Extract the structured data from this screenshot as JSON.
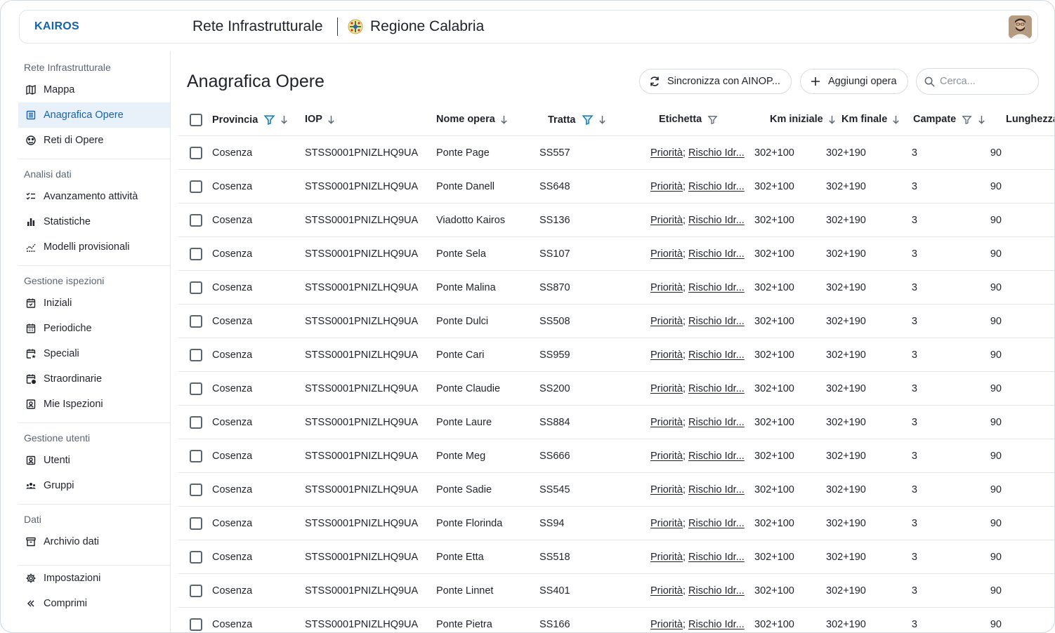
{
  "header": {
    "logo": "KAIROS",
    "app_title": "Rete Infrastrutturale",
    "region": "Regione Calabria"
  },
  "sidebar": {
    "sections": [
      {
        "title": "Rete Infrastrutturale",
        "items": [
          {
            "label": "Mappa",
            "icon": "map-icon"
          },
          {
            "label": "Anagrafica Opere",
            "icon": "table-icon",
            "active": true
          },
          {
            "label": "Reti di Opere",
            "icon": "network-icon"
          }
        ]
      },
      {
        "title": "Analisi dati",
        "items": [
          {
            "label": "Avanzamento attività",
            "icon": "checklist-icon"
          },
          {
            "label": "Statistiche",
            "icon": "bar-chart-icon"
          },
          {
            "label": "Modelli provisionali",
            "icon": "trend-icon"
          }
        ]
      },
      {
        "title": "Gestione ispezioni",
        "items": [
          {
            "label": "Iniziali",
            "icon": "calendar-icon"
          },
          {
            "label": "Periodiche",
            "icon": "calendar-grid-icon"
          },
          {
            "label": "Speciali",
            "icon": "calendar-star-icon"
          },
          {
            "label": "Straordinarie",
            "icon": "calendar-alert-icon"
          },
          {
            "label": "Mie Ispezioni",
            "icon": "user-badge-icon"
          }
        ]
      },
      {
        "title": "Gestione utenti",
        "items": [
          {
            "label": "Utenti",
            "icon": "user-icon"
          },
          {
            "label": "Gruppi",
            "icon": "group-icon"
          }
        ]
      },
      {
        "title": "Dati",
        "items": [
          {
            "label": "Archivio dati",
            "icon": "archive-icon"
          }
        ]
      }
    ],
    "footer": [
      {
        "label": "Impostazioni",
        "icon": "gear-icon"
      },
      {
        "label": "Comprimi",
        "icon": "double-chevron-left-icon"
      }
    ]
  },
  "main": {
    "title": "Anagrafica Opere",
    "sync_button": "Sincronizza con AINOP...",
    "add_button": "Aggiungi opera",
    "search_placeholder": "Cerca..."
  },
  "table": {
    "columns": [
      "Provincia",
      "IOP",
      "Nome opera",
      "Tratta",
      "Etichetta",
      "Km iniziale",
      "Km finale",
      "Campate",
      "Lunghezza"
    ],
    "rows": [
      {
        "provincia": "Cosenza",
        "iop": "STSS0001PNIZLHQ9UA",
        "nome": "Ponte Page",
        "tratta": "SS557",
        "tag1": "Priorità",
        "tag2": "Rischio Idr...",
        "km_iniziale": "302+100",
        "km_finale": "302+190",
        "campate": "3",
        "lunghezza": "90"
      },
      {
        "provincia": "Cosenza",
        "iop": "STSS0001PNIZLHQ9UA",
        "nome": "Ponte Danell",
        "tratta": "SS648",
        "tag1": "Priorità",
        "tag2": "Rischio Idr...",
        "km_iniziale": "302+100",
        "km_finale": "302+190",
        "campate": "3",
        "lunghezza": "90"
      },
      {
        "provincia": "Cosenza",
        "iop": "STSS0001PNIZLHQ9UA",
        "nome": "Viadotto Kairos",
        "tratta": "SS136",
        "tag1": "Priorità",
        "tag2": "Rischio Idr...",
        "km_iniziale": "302+100",
        "km_finale": "302+190",
        "campate": "3",
        "lunghezza": "90"
      },
      {
        "provincia": "Cosenza",
        "iop": "STSS0001PNIZLHQ9UA",
        "nome": "Ponte Sela",
        "tratta": "SS107",
        "tag1": "Priorità",
        "tag2": "Rischio Idr...",
        "km_iniziale": "302+100",
        "km_finale": "302+190",
        "campate": "3",
        "lunghezza": "90"
      },
      {
        "provincia": "Cosenza",
        "iop": "STSS0001PNIZLHQ9UA",
        "nome": "Ponte Malina",
        "tratta": "SS870",
        "tag1": "Priorità",
        "tag2": "Rischio Idr...",
        "km_iniziale": "302+100",
        "km_finale": "302+190",
        "campate": "3",
        "lunghezza": "90"
      },
      {
        "provincia": "Cosenza",
        "iop": "STSS0001PNIZLHQ9UA",
        "nome": "Ponte Dulci",
        "tratta": "SS508",
        "tag1": "Priorità",
        "tag2": "Rischio Idr...",
        "km_iniziale": "302+100",
        "km_finale": "302+190",
        "campate": "3",
        "lunghezza": "90"
      },
      {
        "provincia": "Cosenza",
        "iop": "STSS0001PNIZLHQ9UA",
        "nome": "Ponte Cari",
        "tratta": "SS959",
        "tag1": "Priorità",
        "tag2": "Rischio Idr...",
        "km_iniziale": "302+100",
        "km_finale": "302+190",
        "campate": "3",
        "lunghezza": "90"
      },
      {
        "provincia": "Cosenza",
        "iop": "STSS0001PNIZLHQ9UA",
        "nome": "Ponte Claudie",
        "tratta": "SS200",
        "tag1": "Priorità",
        "tag2": "Rischio Idr...",
        "km_iniziale": "302+100",
        "km_finale": "302+190",
        "campate": "3",
        "lunghezza": "90"
      },
      {
        "provincia": "Cosenza",
        "iop": "STSS0001PNIZLHQ9UA",
        "nome": "Ponte Laure",
        "tratta": "SS884",
        "tag1": "Priorità",
        "tag2": "Rischio Idr...",
        "km_iniziale": "302+100",
        "km_finale": "302+190",
        "campate": "3",
        "lunghezza": "90"
      },
      {
        "provincia": "Cosenza",
        "iop": "STSS0001PNIZLHQ9UA",
        "nome": "Ponte Meg",
        "tratta": "SS666",
        "tag1": "Priorità",
        "tag2": "Rischio Idr...",
        "km_iniziale": "302+100",
        "km_finale": "302+190",
        "campate": "3",
        "lunghezza": "90"
      },
      {
        "provincia": "Cosenza",
        "iop": "STSS0001PNIZLHQ9UA",
        "nome": "Ponte Sadie",
        "tratta": "SS545",
        "tag1": "Priorità",
        "tag2": "Rischio Idr...",
        "km_iniziale": "302+100",
        "km_finale": "302+190",
        "campate": "3",
        "lunghezza": "90"
      },
      {
        "provincia": "Cosenza",
        "iop": "STSS0001PNIZLHQ9UA",
        "nome": "Ponte Florinda",
        "tratta": "SS94",
        "tag1": "Priorità",
        "tag2": "Rischio Idr...",
        "km_iniziale": "302+100",
        "km_finale": "302+190",
        "campate": "3",
        "lunghezza": "90"
      },
      {
        "provincia": "Cosenza",
        "iop": "STSS0001PNIZLHQ9UA",
        "nome": "Ponte Etta",
        "tratta": "SS518",
        "tag1": "Priorità",
        "tag2": "Rischio Idr...",
        "km_iniziale": "302+100",
        "km_finale": "302+190",
        "campate": "3",
        "lunghezza": "90"
      },
      {
        "provincia": "Cosenza",
        "iop": "STSS0001PNIZLHQ9UA",
        "nome": "Ponte Linnet",
        "tratta": "SS401",
        "tag1": "Priorità",
        "tag2": "Rischio Idr...",
        "km_iniziale": "302+100",
        "km_finale": "302+190",
        "campate": "3",
        "lunghezza": "90"
      },
      {
        "provincia": "Cosenza",
        "iop": "STSS0001PNIZLHQ9UA",
        "nome": "Ponte Pietra",
        "tratta": "SS166",
        "tag1": "Priorità",
        "tag2": "Rischio Idr...",
        "km_iniziale": "302+100",
        "km_finale": "302+190",
        "campate": "3",
        "lunghezza": "90"
      }
    ]
  },
  "colors": {
    "accent": "#1763a6",
    "active_bg": "#e8f1f9",
    "filter_active": "#1f7fb8"
  }
}
